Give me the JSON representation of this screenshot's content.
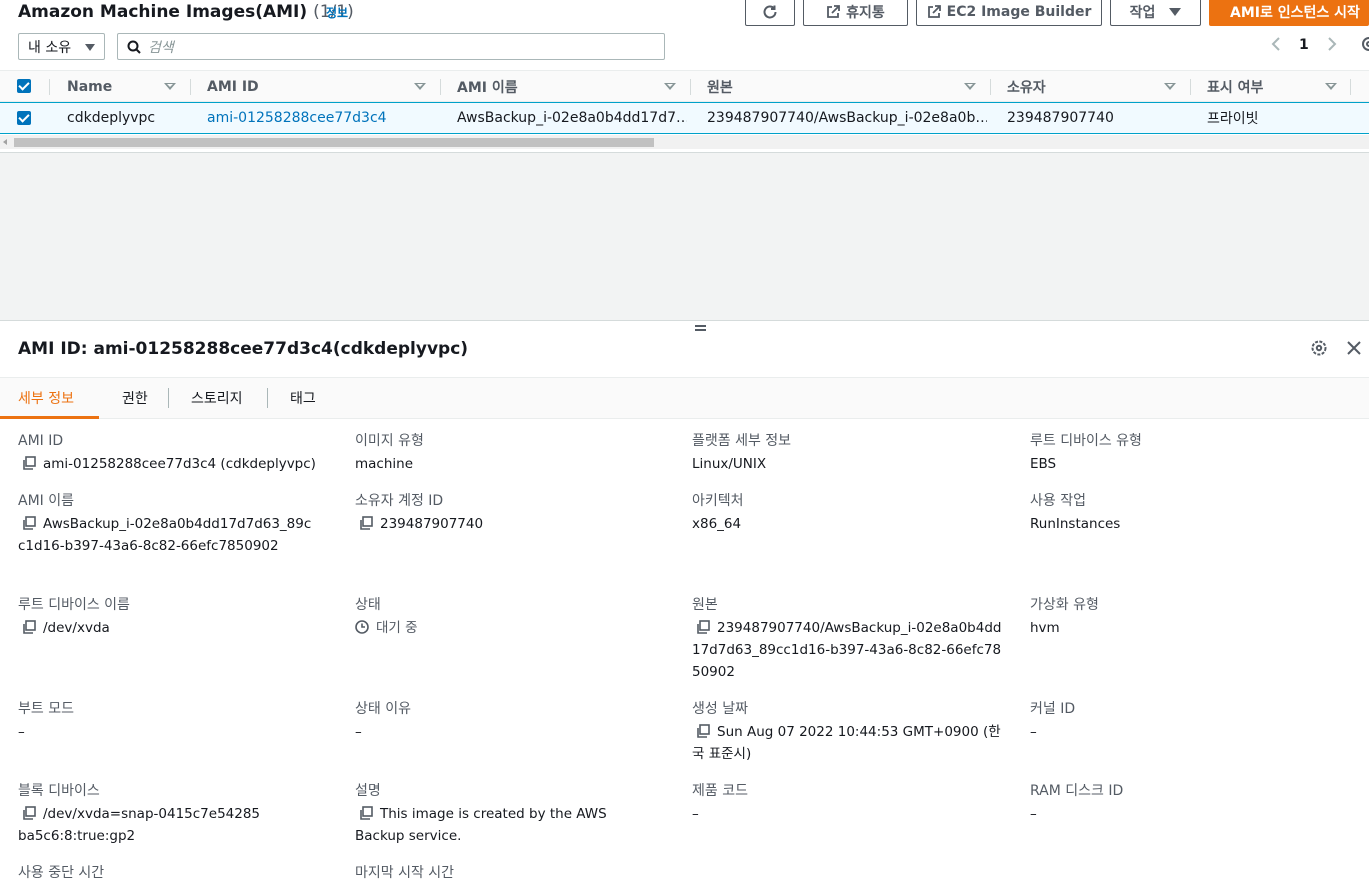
{
  "header": {
    "title": "Amazon Machine Images(AMI)",
    "count": "(1/1)",
    "info_link": "정보",
    "buttons": {
      "recycle_bin": "휴지통",
      "image_builder": "EC2 Image Builder",
      "actions": "작업",
      "launch": "AMI로 인스턴스 시작"
    },
    "owner_filter": "내 소유",
    "search_placeholder": "검색",
    "page_number": "1"
  },
  "table": {
    "columns": [
      "Name",
      "AMI ID",
      "AMI 이름",
      "원본",
      "소유자",
      "표시 여부"
    ],
    "rows": [
      {
        "name": "cdkdeplyvpc",
        "ami_id": "ami-01258288cee77d3c4",
        "ami_name": "AwsBackup_i-02e8a0b4dd17d7…",
        "source": "239487907740/AwsBackup_i-02e8a0b…",
        "owner": "239487907740",
        "visibility": "프라이빗"
      }
    ]
  },
  "details": {
    "title": "AMI ID: ami-01258288cee77d3c4(cdkdeplyvpc)",
    "tabs": [
      "세부 정보",
      "권한",
      "스토리지",
      "태그"
    ],
    "fields": {
      "ami_id": {
        "label": "AMI ID",
        "value": "ami-01258288cee77d3c4 (cdkdeplyvpc)"
      },
      "image_type": {
        "label": "이미지 유형",
        "value": "machine"
      },
      "platform": {
        "label": "플랫폼 세부 정보",
        "value": "Linux/UNIX"
      },
      "root_device_type": {
        "label": "루트 디바이스 유형",
        "value": "EBS"
      },
      "ami_name": {
        "label": "AMI 이름",
        "value": "AwsBackup_i-02e8a0b4dd17d7d63_89cc1d16-b397-43a6-8c82-66efc7850902"
      },
      "owner_account": {
        "label": "소유자 계정 ID",
        "value": "239487907740"
      },
      "architecture": {
        "label": "아키텍처",
        "value": "x86_64"
      },
      "usage_operation": {
        "label": "사용 작업",
        "value": "RunInstances"
      },
      "root_device_name": {
        "label": "루트 디바이스 이름",
        "value": "/dev/xvda"
      },
      "status": {
        "label": "상태",
        "value": "대기 중"
      },
      "source": {
        "label": "원본",
        "value": "239487907740/AwsBackup_i-02e8a0b4dd17d7d63_89cc1d16-b397-43a6-8c82-66efc7850902"
      },
      "virtualization": {
        "label": "가상화 유형",
        "value": "hvm"
      },
      "boot_mode": {
        "label": "부트 모드",
        "value": "–"
      },
      "status_reason": {
        "label": "상태 이유",
        "value": "–"
      },
      "creation_date": {
        "label": "생성 날짜",
        "value": "Sun Aug 07 2022 10:44:53 GMT+0900 (한국 표준시)"
      },
      "kernel_id": {
        "label": "커널 ID",
        "value": "–"
      },
      "block_devices": {
        "label": "블록 디바이스",
        "value": "/dev/xvda=snap-0415c7e54285ba5c6:8:true:gp2"
      },
      "description": {
        "label": "설명",
        "value": "This image is created by the AWS Backup service."
      },
      "product_code": {
        "label": "제품 코드",
        "value": "–"
      },
      "ramdisk_id": {
        "label": "RAM 디스크 ID",
        "value": "–"
      },
      "deprecation_time": {
        "label": "사용 중단 시간"
      },
      "last_launched": {
        "label": "마지막 시작 시간"
      }
    }
  },
  "colors": {
    "accent": "#ec7211",
    "link": "#0073bb",
    "selected_row": "#f1faff"
  }
}
